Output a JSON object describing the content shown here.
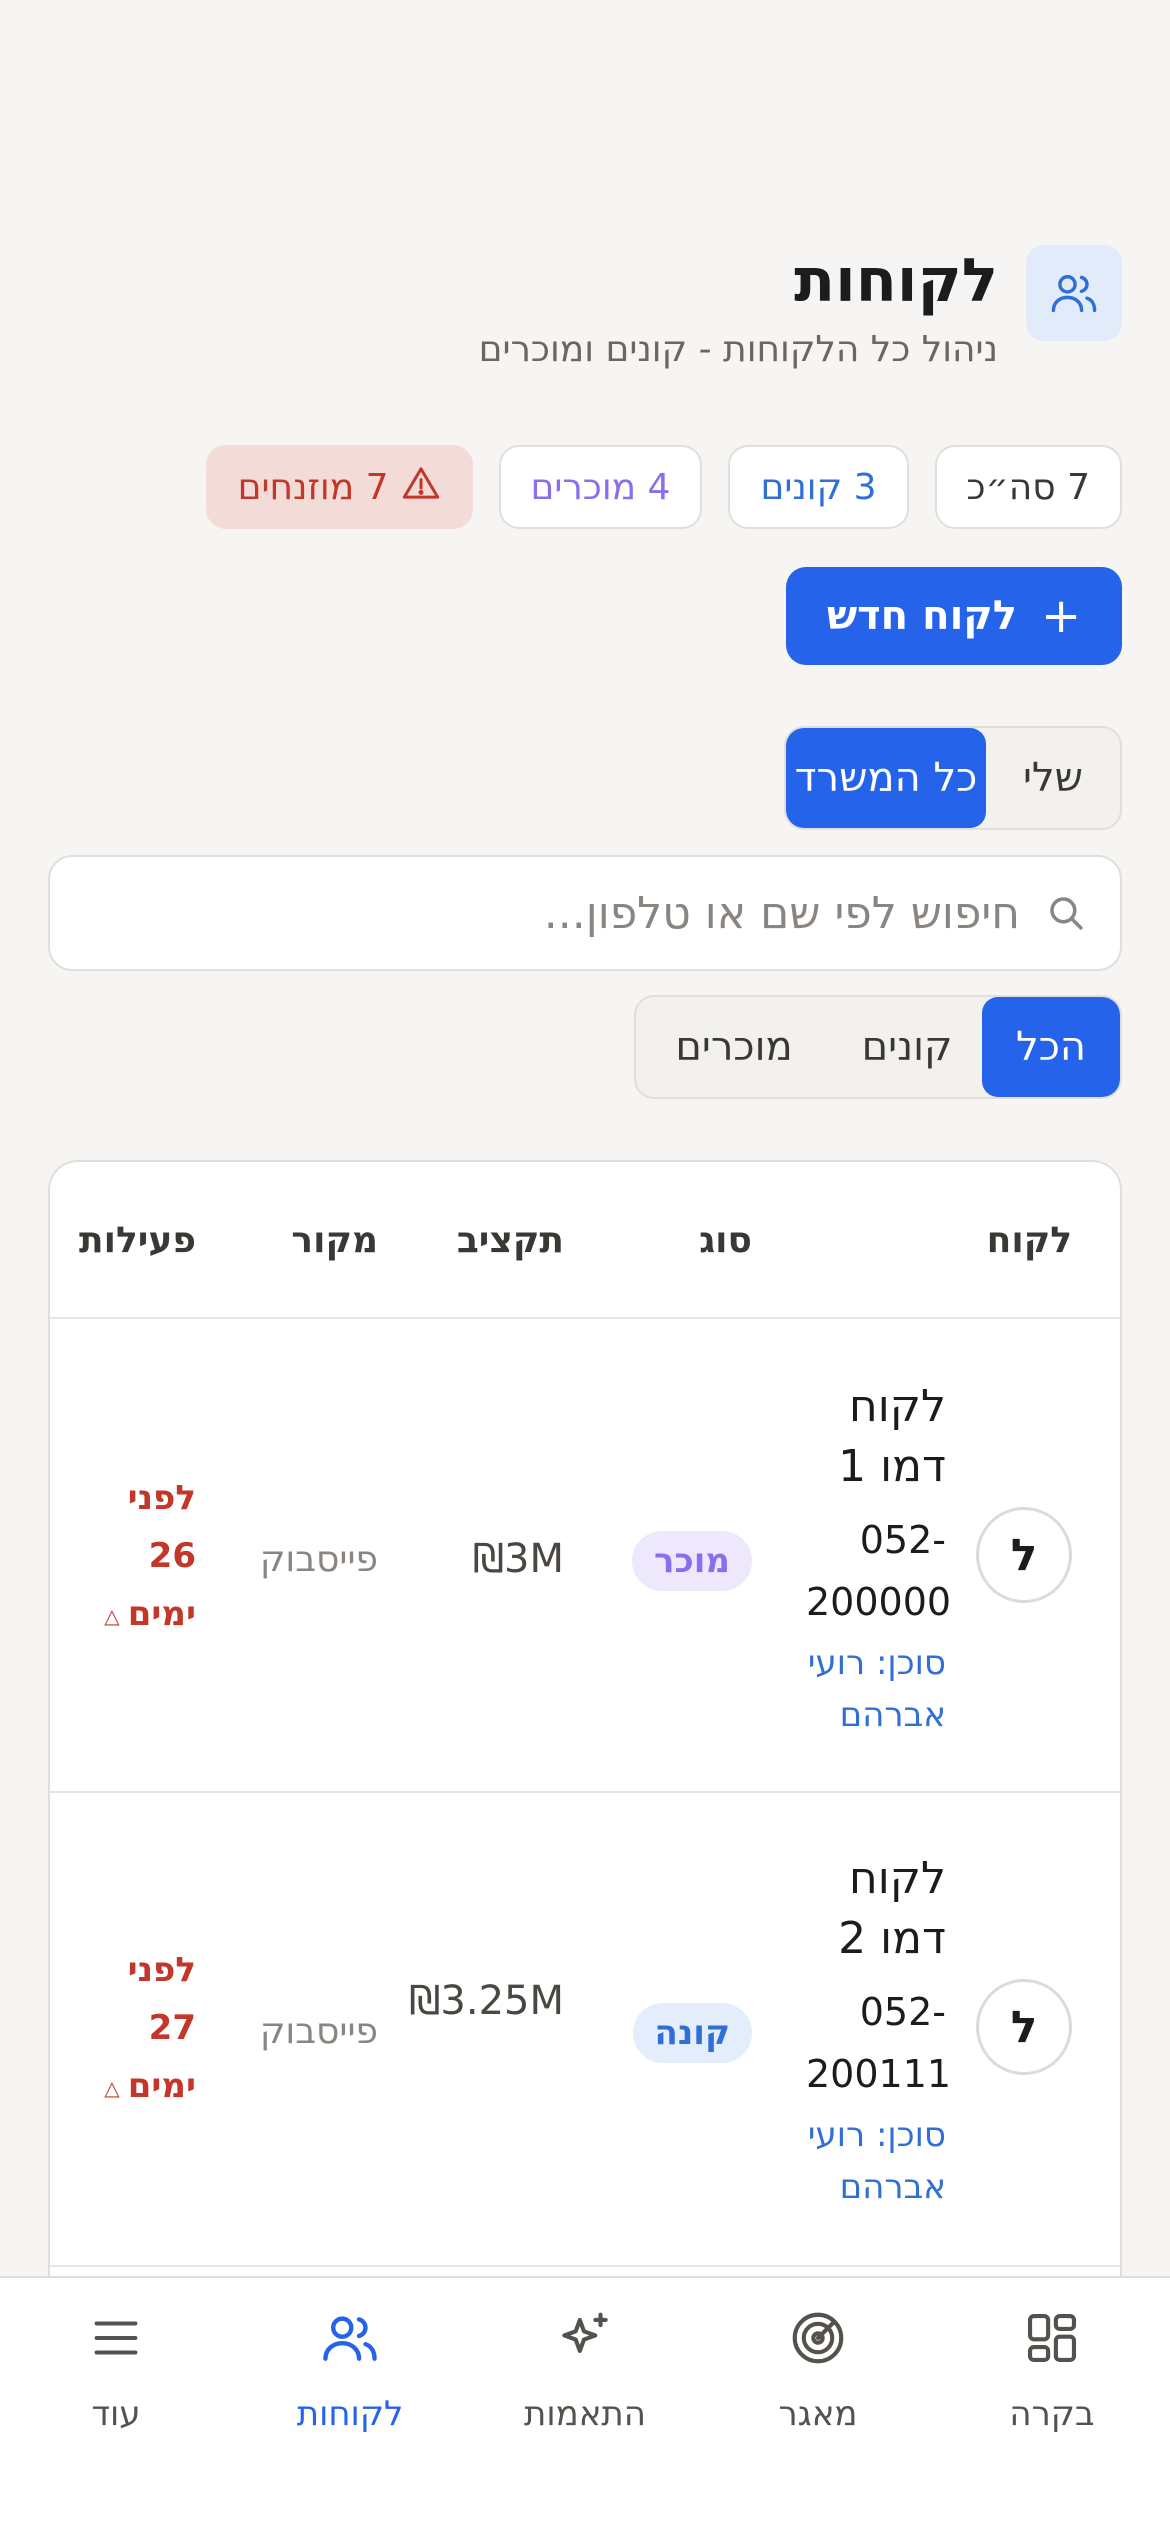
{
  "header": {
    "title": "לקוחות",
    "subtitle": "ניהול כל הלקוחות - קונים ומוכרים",
    "icon": "users-icon"
  },
  "stats": {
    "total": "7 סה״כ",
    "buyers": "3 קונים",
    "sellers": "4 מוכרים",
    "neglected": "7 מוזנחים"
  },
  "actions": {
    "new_client": "לקוח חדש"
  },
  "scope_toggle": {
    "mine": "שלי",
    "all_office": "כל המשרד",
    "selected": "כל המשרד"
  },
  "search": {
    "placeholder": "חיפוש לפי שם או טלפון..."
  },
  "type_filter": {
    "all": "הכל",
    "buyers": "קונים",
    "sellers": "מוכרים",
    "selected": "הכל"
  },
  "table": {
    "columns": {
      "client": "לקוח",
      "type": "סוג",
      "budget": "תקציב",
      "source": "מקור",
      "activity": "פעילות"
    },
    "rows": [
      {
        "initial": "ל",
        "name": "לקוח דמו 1",
        "phone": "052-200000",
        "agent": "סוכן: רועי אברהם",
        "type": "מוכר",
        "budget": "₪3M",
        "source": "פייסבוק",
        "activity": "לפני 26 ימים"
      },
      {
        "initial": "ל",
        "name": "לקוח דמו 2",
        "phone": "052-200111",
        "agent": "סוכן: רועי אברהם",
        "type": "קונה",
        "budget": "₪3.25M",
        "source": "פייסבוק",
        "activity": "לפני 27 ימים"
      }
    ]
  },
  "bottom_nav": {
    "items": [
      {
        "label": "בקרה",
        "icon": "grid-icon"
      },
      {
        "label": "מאגר",
        "icon": "radar-icon"
      },
      {
        "label": "התאמות",
        "icon": "sparkle-icon"
      },
      {
        "label": "לקוחות",
        "icon": "users-icon"
      },
      {
        "label": "עוד",
        "icon": "menu-icon"
      }
    ],
    "active": "לקוחות"
  },
  "colors": {
    "accent": "#2563eb",
    "danger": "#c2372a",
    "seller": "#8b6ef0",
    "buyer": "#2f6fd6",
    "background": "#f6f5f3"
  }
}
